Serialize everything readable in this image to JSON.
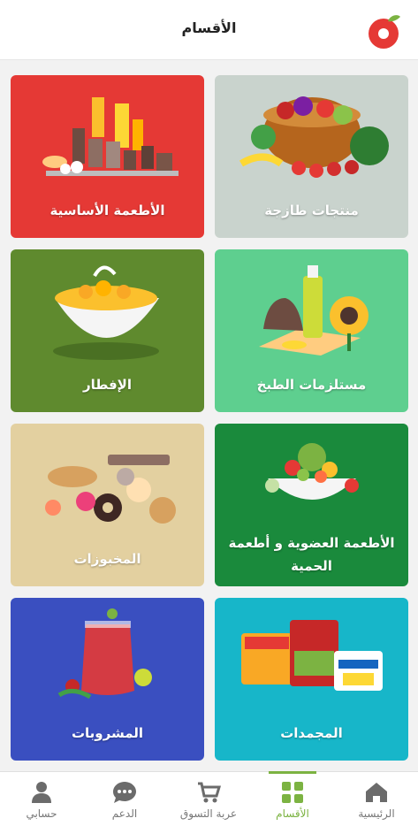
{
  "header": {
    "title": "الأقسام"
  },
  "categories": [
    {
      "label": "منتجات طازجة",
      "color": "#c9d3cd"
    },
    {
      "label": "الأطعمة الأساسية",
      "color": "#e53935"
    },
    {
      "label": "مستلزمات الطبخ",
      "color": "#5ecf8f"
    },
    {
      "label": "الإفطار",
      "color": "#5f8a2e"
    },
    {
      "label": "الأطعمة العضوية و أطعمة الحمية",
      "color": "#1a8a3c"
    },
    {
      "label": "المخبوزات",
      "color": "#e3d0a0"
    },
    {
      "label": "المجمدات",
      "color": "#17b6c9"
    },
    {
      "label": "المشروبات",
      "color": "#3a4fc0"
    }
  ],
  "tabbar": {
    "items": [
      {
        "label": "الرئيسية",
        "icon": "home-icon",
        "active": false
      },
      {
        "label": "الأقسام",
        "icon": "grid-icon",
        "active": true
      },
      {
        "label": "عربة التسوق",
        "icon": "cart-icon",
        "active": false
      },
      {
        "label": "الدعم",
        "icon": "chat-icon",
        "active": false
      },
      {
        "label": "حسابي",
        "icon": "user-icon",
        "active": false
      }
    ],
    "active_color": "#7cb342"
  }
}
